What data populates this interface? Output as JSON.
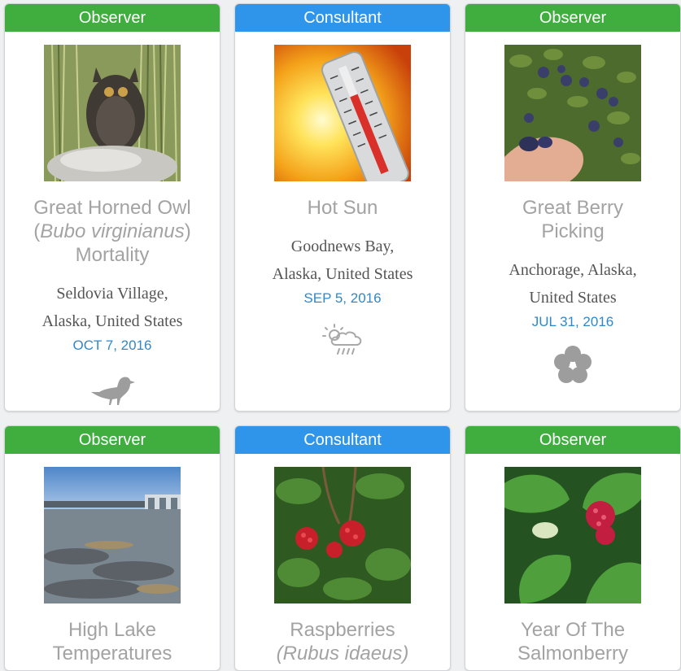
{
  "cards": [
    {
      "role": "Observer",
      "title_common": "Great Horned Owl (",
      "title_latin": "Bubo virginianus",
      "title_rest": ") Mortality",
      "location_line1": "Seldovia Village,",
      "location_line2": "Alaska, United States",
      "date": "OCT 7, 2016",
      "image": "owl-photo",
      "category_icon": "bird-icon"
    },
    {
      "role": "Consultant",
      "title": "Hot Sun",
      "location_line1": "Goodnews Bay,",
      "location_line2": "Alaska, United States",
      "date": "SEP 5, 2016",
      "image": "thermometer-sun-photo",
      "category_icon": "weather-icon"
    },
    {
      "role": "Observer",
      "title_line1": "Great Berry",
      "title_line2": "Picking",
      "location_line1": "Anchorage, Alaska,",
      "location_line2": "United States",
      "date": "JUL 31, 2016",
      "image": "blueberries-photo",
      "category_icon": "flower-icon"
    },
    {
      "role": "Observer",
      "title_line1": "High Lake",
      "title_line2": "Temperatures",
      "image": "lake-photo"
    },
    {
      "role": "Consultant",
      "title_line1": "Raspberries",
      "title_line2": "(Rubus idaeus)",
      "image": "raspberries-photo"
    },
    {
      "role": "Observer",
      "title_line1": "Year Of The",
      "title_line2": "Salmonberry",
      "image": "salmonberry-photo"
    }
  ],
  "colors": {
    "observer": "#3fae3f",
    "consultant": "#2f95ea",
    "date": "#2f88cc",
    "title": "#a3a3a3"
  }
}
